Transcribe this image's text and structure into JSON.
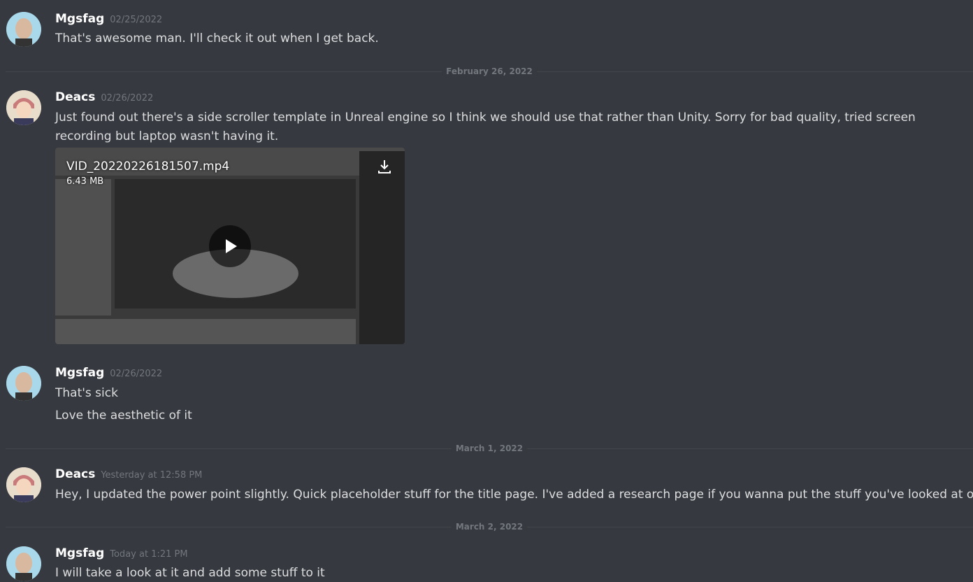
{
  "messages": [
    {
      "user": "Mgsfag",
      "time": "02/25/2022",
      "lines": [
        "That's awesome man. I'll check it out when I get back."
      ]
    },
    {
      "user": "Deacs",
      "time": "02/26/2022",
      "text": "Just found out there's a side scroller template in Unreal engine so I think we should use that rather than Unity. Sorry for bad quality, tried screen recording but laptop wasn't having it.",
      "attachment": {
        "filename": "VID_20220226181507.mp4",
        "size": "6.43 MB"
      }
    },
    {
      "user": "Mgsfag",
      "time": "02/26/2022",
      "lines": [
        "That's sick",
        "Love the aesthetic of it"
      ]
    },
    {
      "user": "Deacs",
      "time": "Yesterday at 12:58 PM",
      "lines": [
        "Hey, I updated the power point slightly. Quick placeholder stuff for the title page. I've added a research page if you wanna put the stuff you've looked at on it."
      ]
    },
    {
      "user": "Mgsfag",
      "time": "Today at 1:21 PM",
      "lines": [
        "I will take a look at it and add some stuff to it"
      ]
    }
  ],
  "dividers": [
    "February 26, 2022",
    "March 1, 2022",
    "March 2, 2022"
  ],
  "colors": {
    "background": "#36393f",
    "username": "#ffffff",
    "timestamp": "#72767d",
    "text": "#dcddde"
  }
}
